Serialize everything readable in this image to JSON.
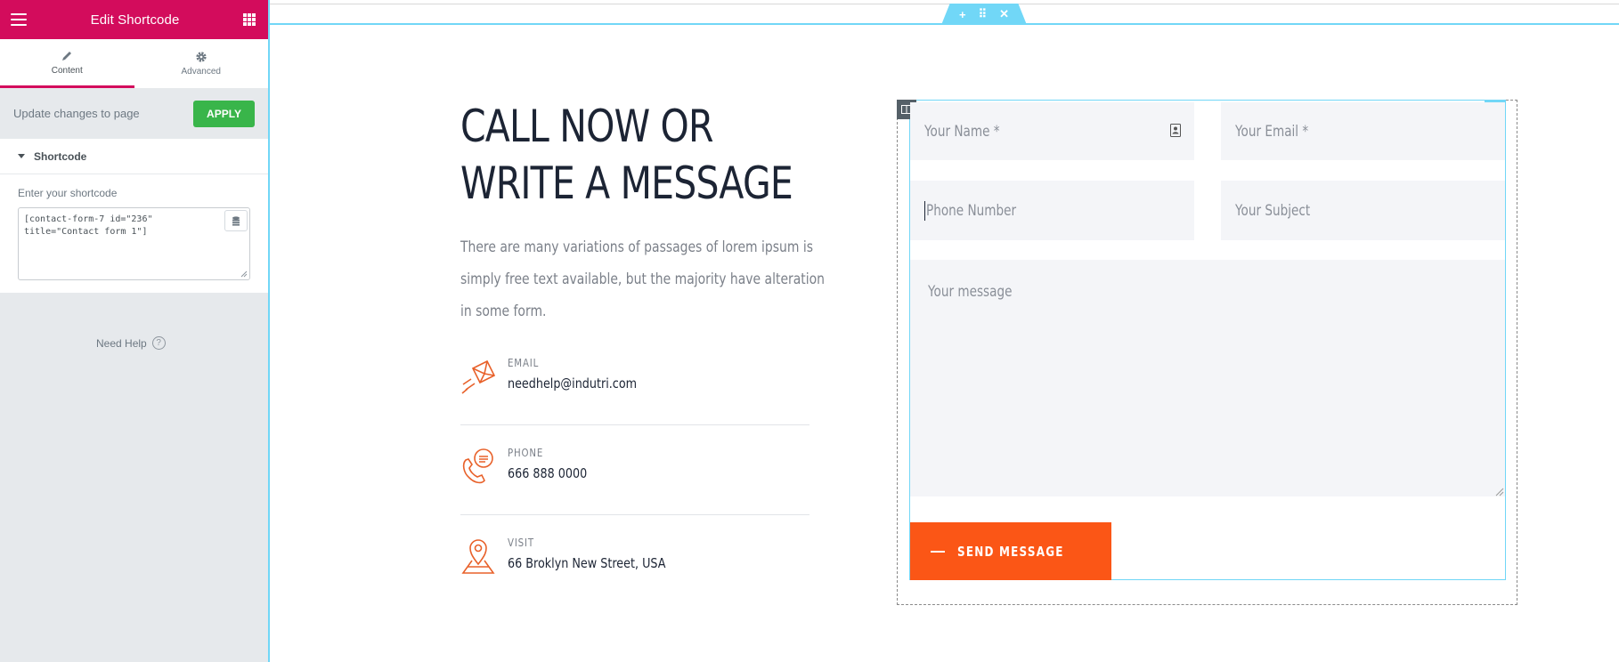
{
  "panel": {
    "title": "Edit Shortcode",
    "tabs": [
      {
        "label": "Content",
        "icon": "pencil-icon",
        "active": true
      },
      {
        "label": "Advanced",
        "icon": "gear-icon",
        "active": false
      }
    ],
    "apply_text": "Update changes to page",
    "apply_button": "APPLY",
    "section_title": "Shortcode",
    "shortcode_label": "Enter your shortcode",
    "shortcode_value": "[contact-form-7 id=\"236\" title=\"Contact form 1\"]",
    "need_help": "Need Help",
    "help_glyph": "?",
    "collapse_glyph": "‹"
  },
  "section_handle": {
    "add": "+",
    "move": "⠿",
    "close": "✕"
  },
  "content": {
    "heading_line1": "CALL NOW OR",
    "heading_line2": "WRITE A MESSAGE",
    "description": "There are many variations of passages of lorem ipsum is simply free text available, but the majority have alteration in some form.",
    "contacts": [
      {
        "kicker": "EMAIL",
        "value": "needhelp@indutri.com",
        "icon": "envelope-icon"
      },
      {
        "kicker": "PHONE",
        "value": "666 888 0000",
        "icon": "phone-icon"
      },
      {
        "kicker": "VISIT",
        "value": "66 Broklyn New Street, USA",
        "icon": "map-pin-icon"
      }
    ]
  },
  "form": {
    "name_placeholder": "Your Name *",
    "email_placeholder": "Your Email *",
    "phone_placeholder": "Phone Number",
    "subject_placeholder": "Your Subject",
    "message_placeholder": "Your message",
    "submit_label": "SEND MESSAGE"
  },
  "colors": {
    "brand": "#d30c5c",
    "apply_green": "#39b54a",
    "accent_orange": "#fb5616",
    "editor_blue": "#71d7f7",
    "heading_dark": "#1c2434"
  }
}
